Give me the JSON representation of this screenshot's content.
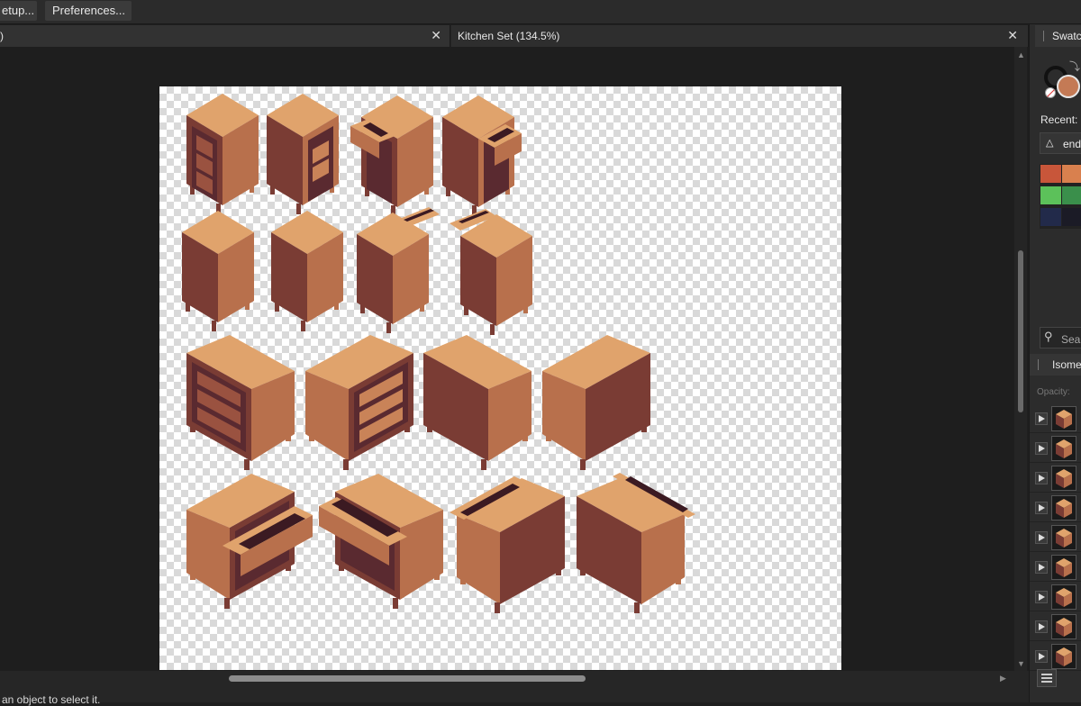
{
  "menu": {
    "setup_label": "etup...",
    "preferences_label": "Preferences..."
  },
  "tabs": [
    {
      "label": ")",
      "close": "✕"
    },
    {
      "label": "Kitchen Set (134.5%)",
      "close": "✕"
    }
  ],
  "right_panel": {
    "tab_label": "Swatc",
    "recent_label": "Recent:",
    "palette_name": "end",
    "search_placeholder": "Sear",
    "layer_group_label": "Isome",
    "opacity_label": "Opacity:",
    "swatches": [
      "#c8563a",
      "#d9804e",
      "#5cc15a",
      "#3a8f4b",
      "#222a4a",
      "#1b1b26"
    ],
    "current_fill": "#c47a55",
    "layer_count": 9
  },
  "status": {
    "hint": "an object to select it."
  },
  "colors": {
    "wood_top": "#e0a36c",
    "wood_left": "#b8704c",
    "wood_right": "#7a3c34",
    "drawer_dark": "#5a2a30",
    "slot": "#3b1a22"
  }
}
